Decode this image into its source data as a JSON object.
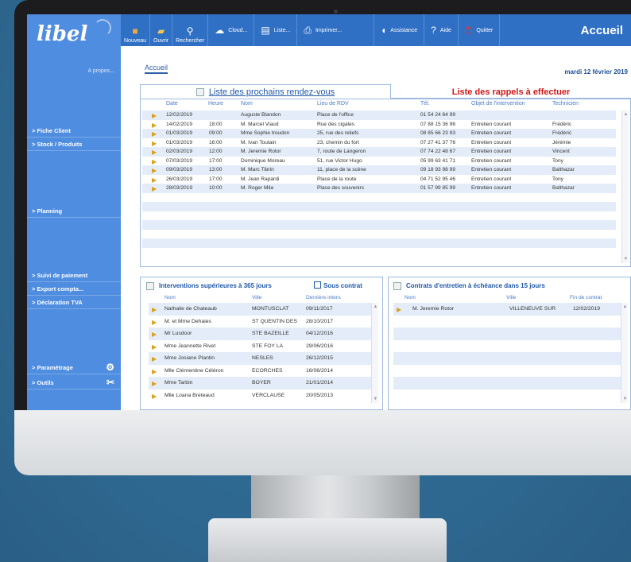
{
  "toolbar": {
    "buttons": [
      {
        "label": "Nouveau",
        "icon": "new-document-icon"
      },
      {
        "label": "Ouvrir",
        "icon": "open-folder-icon"
      },
      {
        "label": "Rechercher",
        "icon": "search-icon"
      }
    ],
    "cloud_label": "Cloud...",
    "liste_label": "Liste...",
    "imprimer_label": "Imprimer...",
    "assistance_label": "Assistance",
    "aide_label": "Aide",
    "quitter_label": "Quitter",
    "accueil_label": "Accueil"
  },
  "sidebar": {
    "logo": "libel",
    "apropos": "A propos...",
    "items": [
      "> Fiche Client",
      "> Stock / Produits",
      "> Planning",
      "> Suivi de paiement",
      "> Export compta...",
      "> Déclaration TVA",
      "> Paramétrage",
      "> Outils"
    ]
  },
  "main": {
    "tab_accueil": "Accueil",
    "date": "mardi 12 février 2019",
    "rdv_title": "Liste des prochains rendez-vous",
    "rappels_title": "Liste des rappels à effectuer",
    "rdv_headers": [
      "Date",
      "Heure",
      "Nom",
      "Lieu de RDV",
      "Tél.",
      "Objet de l'intervention",
      "Technicien"
    ],
    "rdv_rows": [
      {
        "date": "12/02/2019",
        "heure": "",
        "nom": "Auguste Blandon",
        "lieu": "Place de l'office",
        "tel": "01 54 24 64 99",
        "objet": "",
        "tech": ""
      },
      {
        "date": "14/02/2019",
        "heure": "18:00",
        "nom": "M. Marcel Viaud",
        "lieu": "Rue des cigales",
        "tel": "07 88 15 36 96",
        "objet": "Entretien courant",
        "tech": "Frédéric"
      },
      {
        "date": "01/03/2019",
        "heure": "09:00",
        "nom": "Mme Sophie troudon",
        "lieu": "25, rue des reliefs",
        "tel": "08 85 66 23 93",
        "objet": "Entretien courant",
        "tech": "Frédéric"
      },
      {
        "date": "01/03/2019",
        "heure": "16:00",
        "nom": "M. Ivan Toutain",
        "lieu": "23, chemin du fort",
        "tel": "07 27 41 37 76",
        "objet": "Entretien courant",
        "tech": "Jérémie"
      },
      {
        "date": "02/03/2019",
        "heure": "12:00",
        "nom": "M. Jeremie Rotor",
        "lieu": "7, route de Langeron",
        "tel": "07 74 22 48 67",
        "objet": "Entretien courant",
        "tech": "Vincent"
      },
      {
        "date": "07/03/2019",
        "heure": "17:00",
        "nom": "Dominique Moreau",
        "lieu": "51, rue Victor Hugo",
        "tel": "05 99 63 41 71",
        "objet": "Entretien courant",
        "tech": "Tony"
      },
      {
        "date": "09/03/2019",
        "heure": "13:00",
        "nom": "M. Marc Tibrin",
        "lieu": "11, place de la scène",
        "tel": "09 18 93 98 99",
        "objet": "Entretien courant",
        "tech": "Balthazar"
      },
      {
        "date": "26/03/2019",
        "heure": "17:00",
        "nom": "M. Jean Rapardi",
        "lieu": "Place de la route",
        "tel": "04 71 52 95 46",
        "objet": "Entretien courant",
        "tech": "Tony"
      },
      {
        "date": "28/03/2019",
        "heure": "10:00",
        "nom": "M. Roger Mila",
        "lieu": "Place des souvenirs",
        "tel": "01 57 99 85 99",
        "objet": "Entretien courant",
        "tech": "Balthazar"
      }
    ],
    "interv_title": "Interventions supérieures à 365 jours",
    "sous_contrat": "Sous contrat",
    "interv_headers": [
      "Nom",
      "Ville",
      "Dernière interv."
    ],
    "interv_rows": [
      {
        "nom": "Nathalie de Chateaub",
        "ville": "MONTUSCLAT",
        "date": "09/11/2017"
      },
      {
        "nom": "M. et Mme Dehaies",
        "ville": "ST QUENTIN DES",
        "date": "28/10/2017"
      },
      {
        "nom": "Mr Lusdoor",
        "ville": "STE BAZEILLE",
        "date": "04/12/2016"
      },
      {
        "nom": "Mme Jeannette Rivet",
        "ville": "STE FOY LA",
        "date": "29/06/2016"
      },
      {
        "nom": "Mme Josiane Plantin",
        "ville": "NESLES",
        "date": "26/12/2015"
      },
      {
        "nom": "Mlle Clémentine Céléron",
        "ville": "ECORCHES",
        "date": "16/06/2014"
      },
      {
        "nom": "Mme Tarbin",
        "ville": "BOYER",
        "date": "21/01/2014"
      },
      {
        "nom": "Mlle Loana Breteaud",
        "ville": "VERCLAUSE",
        "date": "20/05/2013"
      }
    ],
    "contrats_title": "Contrats d'entretien à échéance dans 15 jours",
    "contrats_headers": [
      "Nom",
      "Ville",
      "Fin de contrat"
    ],
    "contrats_rows": [
      {
        "nom": "M. Jeremie Rotor",
        "ville": "VILLENEUVE SUR",
        "date": "12/02/2019"
      }
    ]
  }
}
